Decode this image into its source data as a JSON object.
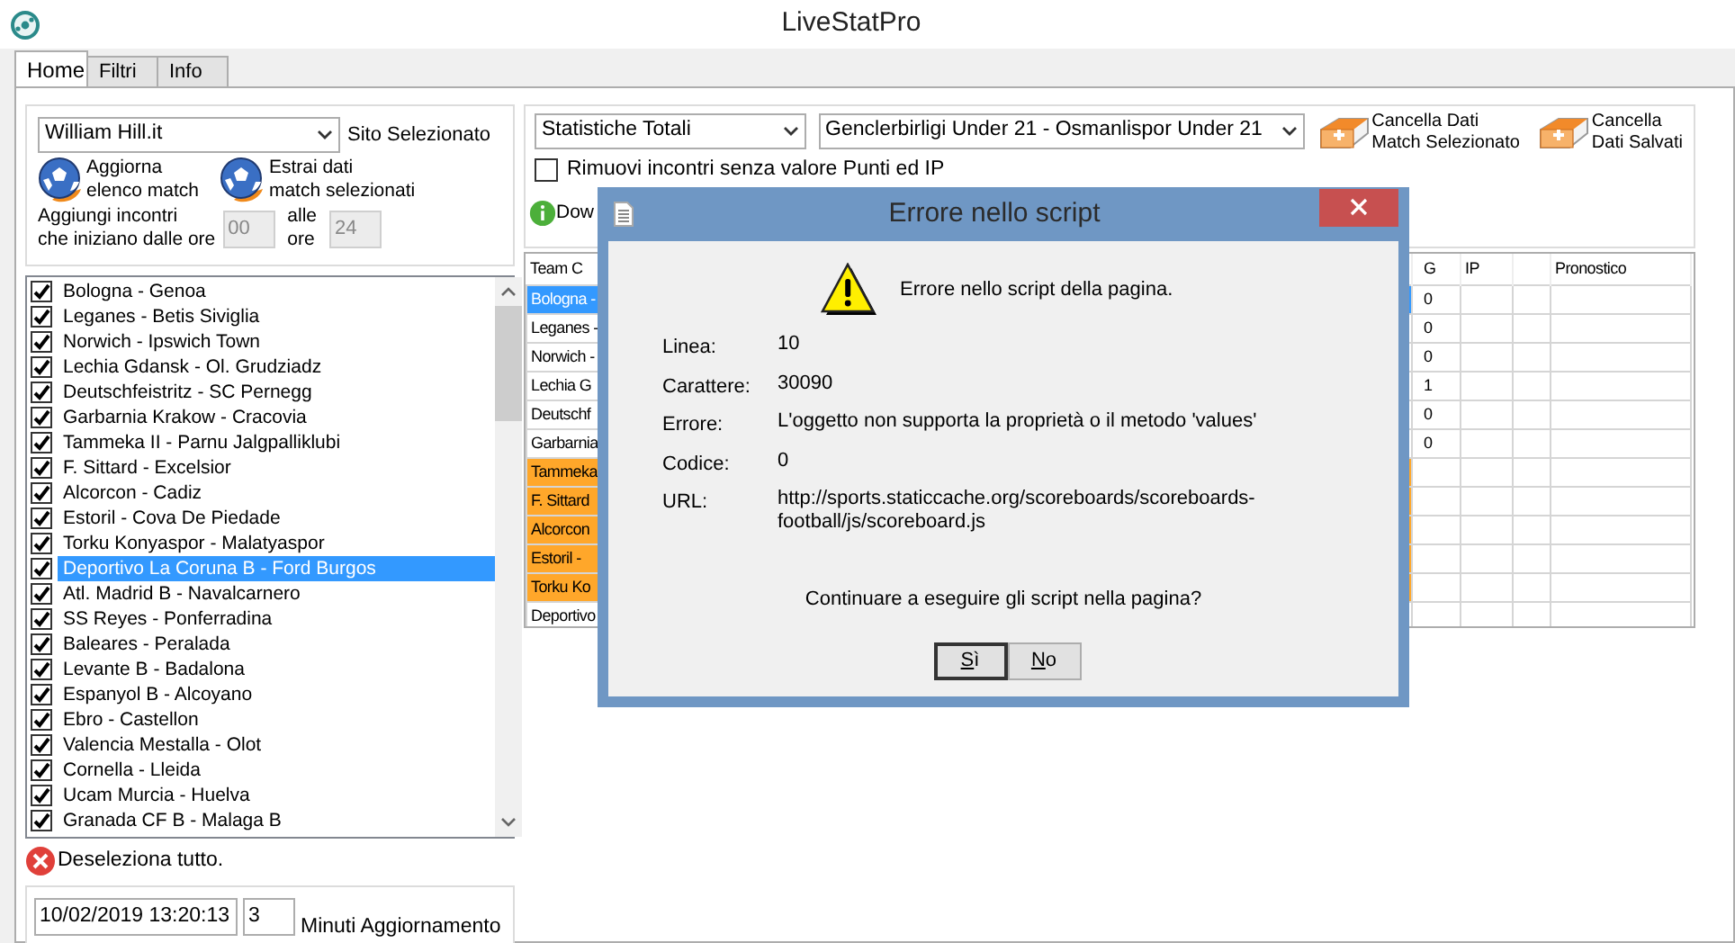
{
  "window": {
    "title": "LiveStatPro"
  },
  "tabs": [
    {
      "label": "Home",
      "selected": true
    },
    {
      "label": "Filtri",
      "selected": false
    },
    {
      "label": "Info",
      "selected": false
    }
  ],
  "site": {
    "value": "William Hill.it",
    "label": "Sito Selezionato"
  },
  "actions": [
    {
      "label": "Aggiorna\nelenco match"
    },
    {
      "label": "Estrai dati\nmatch selezionati"
    }
  ],
  "time_filter": {
    "label": "Aggiungi incontri\nche iniziano dalle ore",
    "from": "00",
    "to_label": "alle\nore",
    "to": "24"
  },
  "matches": [
    {
      "label": "Bologna  - Genoa",
      "checked": true,
      "selected": false
    },
    {
      "label": "Leganes  - Betis Siviglia",
      "checked": true,
      "selected": false
    },
    {
      "label": "Norwich  - Ipswich Town",
      "checked": true,
      "selected": false
    },
    {
      "label": "Lechia Gdansk  - Ol. Grudziadz",
      "checked": true,
      "selected": false
    },
    {
      "label": "Deutschfeistritz  - SC Pernegg",
      "checked": true,
      "selected": false
    },
    {
      "label": "Garbarnia Krakow  - Cracovia",
      "checked": true,
      "selected": false
    },
    {
      "label": "Tammeka II  - Parnu Jalgpalliklubi",
      "checked": true,
      "selected": false
    },
    {
      "label": "F. Sittard  - Excelsior",
      "checked": true,
      "selected": false
    },
    {
      "label": "Alcorcon  - Cadiz",
      "checked": true,
      "selected": false
    },
    {
      "label": "Estoril  - Cova De Piedade",
      "checked": true,
      "selected": false
    },
    {
      "label": "Torku Konyaspor  - Malatyaspor",
      "checked": true,
      "selected": false
    },
    {
      "label": "Deportivo La Coruna B  - Ford Burgos",
      "checked": true,
      "selected": true
    },
    {
      "label": "Atl. Madrid B  - Navalcarnero",
      "checked": true,
      "selected": false
    },
    {
      "label": "SS Reyes  - Ponferradina",
      "checked": true,
      "selected": false
    },
    {
      "label": "Baleares  - Peralada",
      "checked": true,
      "selected": false
    },
    {
      "label": "Levante B  - Badalona",
      "checked": true,
      "selected": false
    },
    {
      "label": "Espanyol B  - Alcoyano",
      "checked": true,
      "selected": false
    },
    {
      "label": "Ebro  - Castellon",
      "checked": true,
      "selected": false
    },
    {
      "label": "Valencia Mestalla  - Olot",
      "checked": true,
      "selected": false
    },
    {
      "label": "Cornella  - Lleida",
      "checked": true,
      "selected": false
    },
    {
      "label": "Ucam Murcia  - Huelva",
      "checked": true,
      "selected": false
    },
    {
      "label": "Granada CF B  - Malaga B",
      "checked": true,
      "selected": false
    }
  ],
  "deselect_all": "Deseleziona tutto.",
  "update": {
    "datetime": "10/02/2019 13:20:13",
    "minutes": "3",
    "label": "Minuti Aggiornamento"
  },
  "stats_select": "Statistiche Totali",
  "match_select": "Genclerbirligi Under 21 - Osmanlispor Under 21",
  "clear_buttons": [
    {
      "label": "Cancella Dati\nMatch Selezionato"
    },
    {
      "label": "Cancella\nDati Salvati"
    }
  ],
  "remove_checkbox": {
    "label": "Rimuovi incontri senza valore Punti ed IP",
    "checked": false
  },
  "download_label": "Dow",
  "table": {
    "columns": [
      {
        "label": "Team C",
        "kind": "team"
      },
      {
        "label": "G",
        "kind": "rg"
      },
      {
        "label": "IP",
        "kind": "ip"
      },
      {
        "kind": "blank"
      },
      {
        "label": "Pronostico",
        "kind": "pron"
      }
    ],
    "rows": [
      {
        "team": "Bologna -",
        "rg": "0",
        "selected": true
      },
      {
        "team": "Leganes -",
        "rg": "0",
        "selected": false
      },
      {
        "team": "Norwich -",
        "rg": "0",
        "selected": false
      },
      {
        "team": "Lechia G",
        "rg": "1",
        "selected": false
      },
      {
        "team": "Deutschf",
        "rg": "0",
        "selected": false
      },
      {
        "team": "Garbarnia",
        "rg": "0",
        "selected": false
      },
      {
        "team": "Tammeka",
        "selected": false,
        "color": "#ffa72a"
      },
      {
        "team": "F. Sittard",
        "selected": false,
        "color": "#ffa72a"
      },
      {
        "team": "Alcorcon",
        "selected": false,
        "color": "#ffa72a"
      },
      {
        "team": "Estoril -",
        "selected": false,
        "color": "#ffa72a"
      },
      {
        "team": "Torku Ko",
        "selected": false,
        "color": "#ffa72a"
      },
      {
        "team": "Deportivo",
        "selected": false
      }
    ]
  },
  "dialog": {
    "title": "Errore nello script",
    "message": "Errore nello script della pagina.",
    "fields": [
      {
        "label": "Linea:",
        "value": "10"
      },
      {
        "label": "Carattere:",
        "value": "30090"
      },
      {
        "label": "Errore:",
        "value": "L'oggetto non supporta la proprietà o il metodo 'values'"
      },
      {
        "label": "Codice:",
        "value": "0"
      },
      {
        "label": "URL:",
        "value": "http://sports.staticcache.org/scoreboards/scoreboards-football/js/scoreboard.js"
      }
    ],
    "question": "Continuare a eseguire gli script nella pagina?",
    "buttons": [
      {
        "label": "Sì",
        "selected": true
      },
      {
        "label": "No",
        "selected": false
      }
    ]
  }
}
